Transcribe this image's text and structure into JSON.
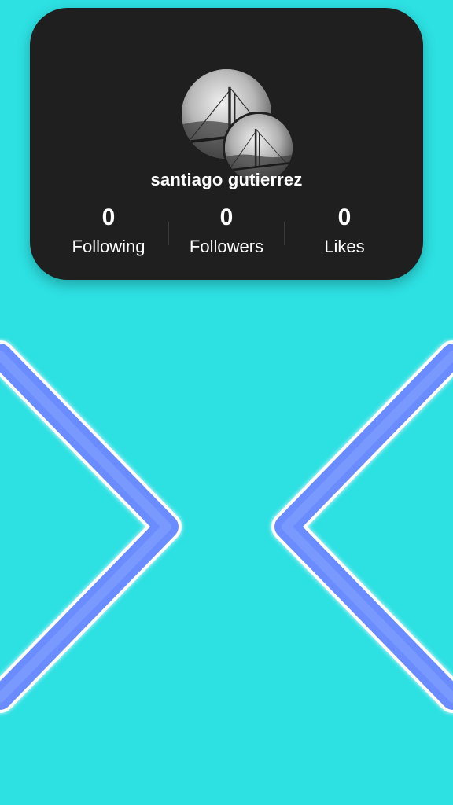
{
  "profile": {
    "username": "santiago gutierrez",
    "avatar_icon": "profile-photo",
    "stats": [
      {
        "value": "0",
        "label": "Following"
      },
      {
        "value": "0",
        "label": "Followers"
      },
      {
        "value": "0",
        "label": "Likes"
      }
    ]
  },
  "navigation": {
    "previous_icon": "chevron-left-icon",
    "next_icon": "chevron-right-icon"
  },
  "colors": {
    "background": "#2de0e2",
    "card": "#1f1f1f",
    "chevron": "#6a8cff",
    "text": "#ffffff"
  }
}
